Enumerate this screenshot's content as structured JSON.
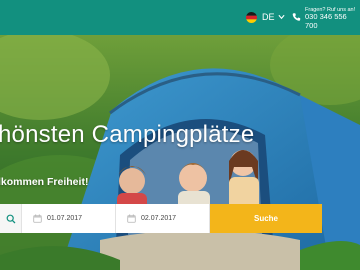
{
  "header": {
    "language": "DE",
    "phone_label": "Fragen? Ruf uns an!",
    "phone_number": "030 346 556 700"
  },
  "hero": {
    "headline": "hönsten Campingplätze",
    "subline": "lkommen Freiheit!"
  },
  "search": {
    "arrival_date": "01.07.2017",
    "departure_date": "02.07.2017",
    "submit_label": "Suche"
  },
  "colors": {
    "header_bg": "#12907f",
    "submit_bg": "#f3b51a"
  },
  "icons": [
    "german-flag-icon",
    "chevron-down-icon",
    "phone-icon",
    "search-icon",
    "calendar-icon"
  ]
}
